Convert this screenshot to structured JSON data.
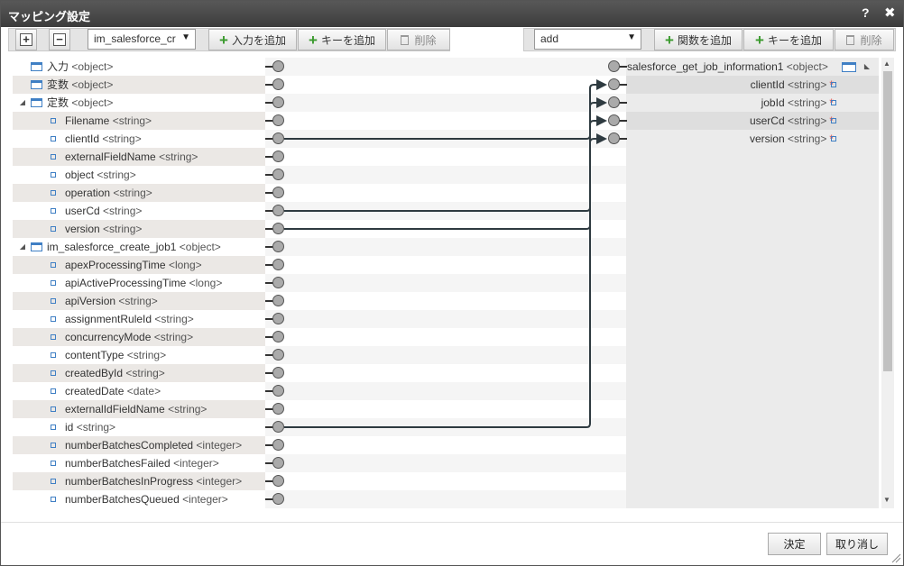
{
  "dialog": {
    "title": "マッピング設定",
    "help_label": "?",
    "close_label": "✖"
  },
  "toolbar": {
    "expand_all": "+",
    "collapse_all": "−",
    "source_select": "im_salesforce_cr",
    "add_input": "入力を追加",
    "add_key_left": "キーを追加",
    "delete_left": "削除",
    "function_select": "add",
    "add_function": "関数を追加",
    "add_key_right": "キーを追加",
    "delete_right": "削除"
  },
  "left_tree": [
    {
      "name": "入力",
      "type": "<object>",
      "kind": "object",
      "expander": ""
    },
    {
      "name": "変数",
      "type": "<object>",
      "kind": "object",
      "expander": ""
    },
    {
      "name": "定数",
      "type": "<object>",
      "kind": "object",
      "expander": "◢"
    },
    {
      "name": "Filename",
      "type": "<string>",
      "kind": "leaf"
    },
    {
      "name": "clientId",
      "type": "<string>",
      "kind": "leaf"
    },
    {
      "name": "externalFieldName",
      "type": "<string>",
      "kind": "leaf"
    },
    {
      "name": "object",
      "type": "<string>",
      "kind": "leaf"
    },
    {
      "name": "operation",
      "type": "<string>",
      "kind": "leaf"
    },
    {
      "name": "userCd",
      "type": "<string>",
      "kind": "leaf"
    },
    {
      "name": "version",
      "type": "<string>",
      "kind": "leaf"
    },
    {
      "name": "im_salesforce_create_job1",
      "type": "<object>",
      "kind": "object",
      "expander": "◢"
    },
    {
      "name": "apexProcessingTime",
      "type": "<long>",
      "kind": "leaf"
    },
    {
      "name": "apiActiveProcessingTime",
      "type": "<long>",
      "kind": "leaf"
    },
    {
      "name": "apiVersion",
      "type": "<string>",
      "kind": "leaf"
    },
    {
      "name": "assignmentRuleId",
      "type": "<string>",
      "kind": "leaf"
    },
    {
      "name": "concurrencyMode",
      "type": "<string>",
      "kind": "leaf"
    },
    {
      "name": "contentType",
      "type": "<string>",
      "kind": "leaf"
    },
    {
      "name": "createdById",
      "type": "<string>",
      "kind": "leaf"
    },
    {
      "name": "createdDate",
      "type": "<date>",
      "kind": "leaf"
    },
    {
      "name": "externalIdFieldName",
      "type": "<string>",
      "kind": "leaf"
    },
    {
      "name": "id",
      "type": "<string>",
      "kind": "leaf"
    },
    {
      "name": "numberBatchesCompleted",
      "type": "<integer>",
      "kind": "leaf"
    },
    {
      "name": "numberBatchesFailed",
      "type": "<integer>",
      "kind": "leaf"
    },
    {
      "name": "numberBatchesInProgress",
      "type": "<integer>",
      "kind": "leaf"
    },
    {
      "name": "numberBatchesQueued",
      "type": "<integer>",
      "kind": "leaf"
    }
  ],
  "right_tree": [
    {
      "name": "salesforce_get_job_information1",
      "type": "<object>",
      "kind": "object",
      "required": false
    },
    {
      "name": "clientId",
      "type": "<string>",
      "kind": "leaf",
      "required": true
    },
    {
      "name": "jobId",
      "type": "<string>",
      "kind": "leaf",
      "required": true
    },
    {
      "name": "userCd",
      "type": "<string>",
      "kind": "leaf",
      "required": true
    },
    {
      "name": "version",
      "type": "<string>",
      "kind": "leaf",
      "required": true
    }
  ],
  "required_mark": "*",
  "mappings": [
    {
      "from": "clientId",
      "to": "clientId"
    },
    {
      "from": "id",
      "to": "jobId"
    },
    {
      "from": "userCd",
      "to": "userCd"
    },
    {
      "from": "version",
      "to": "version"
    }
  ],
  "footer": {
    "ok_label": "決定",
    "cancel_label": "取り消し"
  }
}
